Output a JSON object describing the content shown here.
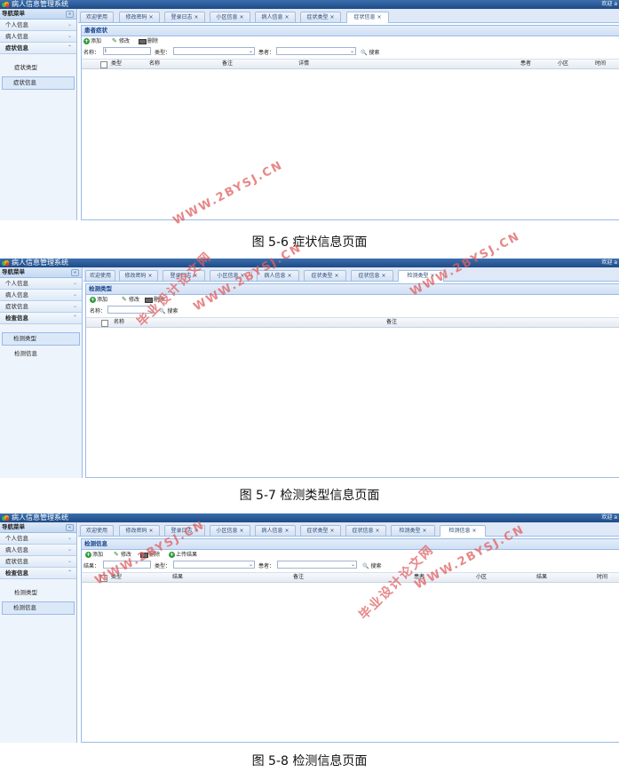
{
  "app_title": "病人信息管理系统",
  "welcome": "欢迎 a",
  "nav_title": "导航菜单",
  "nav_groups": [
    "个人信息",
    "病人信息",
    "症状信息",
    "检查信息"
  ],
  "screens": [
    {
      "caption": "图 5-6 症状信息页面",
      "tabs": [
        "欢迎使用",
        "修改密码 ×",
        "登录日志 ×",
        "小区信息 ×",
        "病人信息 ×",
        "症状类型 ×",
        "症状信息 ×"
      ],
      "sub_items": [
        "症状类型",
        "症状信息"
      ],
      "panel_title": "患者症状",
      "toolbar": {
        "add": "添加",
        "edit": "修改",
        "delete": "删除"
      },
      "search": {
        "name_label": "名称：",
        "type_label": "类型：",
        "patient_label": "患者：",
        "search_btn": "搜索"
      },
      "columns": [
        "类型",
        "名称",
        "备注",
        "详情",
        "患者",
        "小区",
        "时间"
      ]
    },
    {
      "caption": "图 5-7 检测类型信息页面",
      "tabs": [
        "欢迎使用",
        "修改密码 ×",
        "登录日志 ×",
        "小区信息 ×",
        "病人信息 ×",
        "症状类型 ×",
        "症状信息 ×",
        "检测类型 ×"
      ],
      "sub_items": [
        "检测类型",
        "检测信息"
      ],
      "panel_title": "检测类型",
      "toolbar": {
        "add": "添加",
        "edit": "修改",
        "delete": "删除"
      },
      "search": {
        "name_label": "名称：",
        "search_btn": "搜索"
      },
      "columns": [
        "名称",
        "备注"
      ]
    },
    {
      "caption": "图 5-8 检测信息页面",
      "tabs": [
        "欢迎使用",
        "修改密码 ×",
        "登录日志 ×",
        "小区信息 ×",
        "病人信息 ×",
        "症状类型 ×",
        "症状信息 ×",
        "检测类型 ×",
        "检测信息 ×"
      ],
      "sub_items": [
        "检测类型",
        "检测信息"
      ],
      "panel_title": "检测信息",
      "toolbar": {
        "add": "添加",
        "edit": "修改",
        "delete": "删除",
        "upload": "上传结果"
      },
      "search": {
        "result_label": "结果：",
        "type_label": "类型：",
        "patient_label": "患者：",
        "search_btn": "搜索"
      },
      "columns": [
        "类型",
        "结果",
        "备注",
        "患者",
        "小区",
        "结果",
        "时间"
      ]
    }
  ],
  "watermarks": {
    "url": "WWW.2BYSJ.CN",
    "site": "毕业设计论文网"
  },
  "colors": {
    "appbar": "#1d4a86",
    "accent": "#99bbe8",
    "watermark": "#e06060"
  }
}
